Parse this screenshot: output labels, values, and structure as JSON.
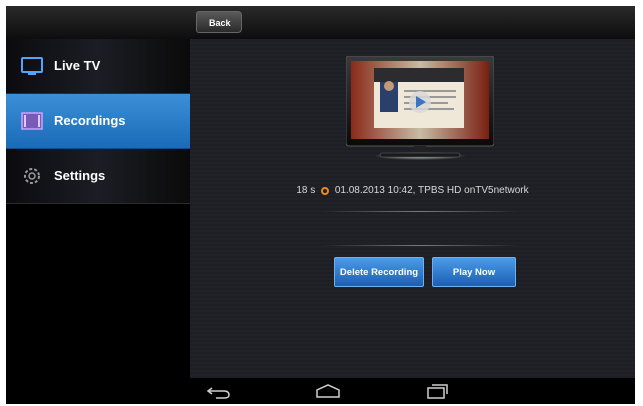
{
  "topbar": {
    "back_label": "Back"
  },
  "sidebar": {
    "items": [
      {
        "label": "Live TV",
        "icon": "tv-icon",
        "active": false
      },
      {
        "label": "Recordings",
        "icon": "film-icon",
        "active": true
      },
      {
        "label": "Settings",
        "icon": "gear-icon",
        "active": false
      }
    ]
  },
  "recording": {
    "duration": "18 s",
    "details": "01.08.2013 10:42, TPBS HD onTV5network"
  },
  "actions": {
    "delete_label": "Delete Recording",
    "play_label": "Play Now"
  },
  "system_nav": [
    "back-icon",
    "home-icon",
    "recent-apps-icon"
  ],
  "colors": {
    "accent": "#2a7fd0",
    "clock": "#f08a1c"
  }
}
